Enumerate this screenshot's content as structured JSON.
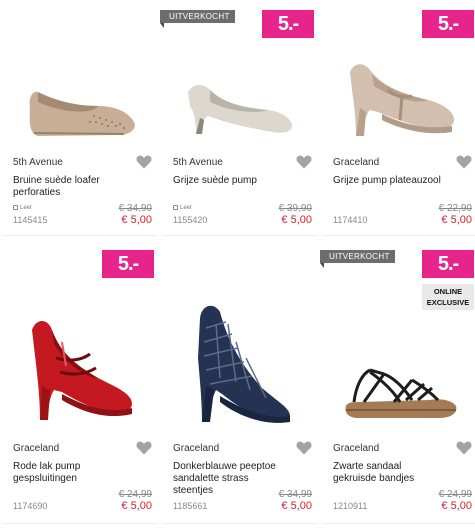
{
  "badges": {
    "price": "5.-",
    "sold_out": "UITVERKOCHT",
    "online_line1": "ONLINE",
    "online_line2": "EXCLUSIVE"
  },
  "colors": {
    "badge_pink": "#e6248b",
    "sale_red": "#d4202a",
    "sold_out_grey": "#6d6d6d"
  },
  "products": [
    {
      "brand": "5th Avenue",
      "name": "Bruine suède loafer perforaties",
      "material": "Leer",
      "article": "1145415",
      "old_price": "€ 34,90",
      "new_price": "€ 5,00",
      "shoe": "loafer-beige-icon"
    },
    {
      "brand": "5th Avenue",
      "name": "Grijze suède pump",
      "material": "Leer",
      "article": "1155420",
      "old_price": "€ 39,90",
      "new_price": "€ 5,00",
      "shoe": "pump-grey-icon"
    },
    {
      "brand": "Graceland",
      "name": "Grijze pump plateauzool",
      "material": "",
      "article": "1174410",
      "old_price": "€ 22,90",
      "new_price": "€ 5,00",
      "shoe": "platform-pump-icon"
    },
    {
      "brand": "Graceland",
      "name": "Rode lak pump gespsluitingen",
      "material": "",
      "article": "1174690",
      "old_price": "€ 24,99",
      "new_price": "€ 5,00",
      "shoe": "red-pump-icon"
    },
    {
      "brand": "Graceland",
      "name": "Donkerblauwe peeptoe sandalette strass steentjes",
      "material": "",
      "article": "1185661",
      "old_price": "€ 34,99",
      "new_price": "€ 5,00",
      "shoe": "navy-sandal-icon"
    },
    {
      "brand": "Graceland",
      "name": "Zwarte sandaal gekruisde bandjes",
      "material": "",
      "article": "1210911",
      "old_price": "€ 24,99",
      "new_price": "€ 5,00",
      "shoe": "black-sandal-icon"
    }
  ]
}
